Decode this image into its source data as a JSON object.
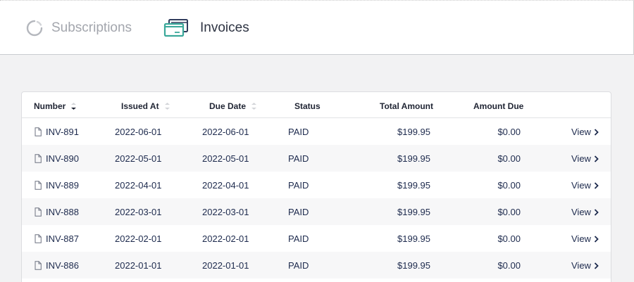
{
  "tabs": {
    "subscriptions": {
      "label": "Subscriptions",
      "icon": "loading-spinner-icon"
    },
    "invoices": {
      "label": "Invoices",
      "icon": "credit-cards-icon",
      "active": true
    }
  },
  "colors": {
    "accent": "#3aa89a",
    "inactive": "#a3a6ad",
    "text": "#1d2a4d"
  },
  "table": {
    "columns": {
      "number": "Number",
      "issued_at": "Issued At",
      "due_date": "Due Date",
      "status": "Status",
      "total_amount": "Total Amount",
      "amount_due": "Amount Due"
    },
    "rows": [
      {
        "number": "INV-891",
        "issued_at": "2022-06-01",
        "due_date": "2022-06-01",
        "status": "PAID",
        "total": "$199.95",
        "due": "$0.00",
        "action": "View"
      },
      {
        "number": "INV-890",
        "issued_at": "2022-05-01",
        "due_date": "2022-05-01",
        "status": "PAID",
        "total": "$199.95",
        "due": "$0.00",
        "action": "View"
      },
      {
        "number": "INV-889",
        "issued_at": "2022-04-01",
        "due_date": "2022-04-01",
        "status": "PAID",
        "total": "$199.95",
        "due": "$0.00",
        "action": "View"
      },
      {
        "number": "INV-888",
        "issued_at": "2022-03-01",
        "due_date": "2022-03-01",
        "status": "PAID",
        "total": "$199.95",
        "due": "$0.00",
        "action": "View"
      },
      {
        "number": "INV-887",
        "issued_at": "2022-02-01",
        "due_date": "2022-02-01",
        "status": "PAID",
        "total": "$199.95",
        "due": "$0.00",
        "action": "View"
      },
      {
        "number": "INV-886",
        "issued_at": "2022-01-01",
        "due_date": "2022-01-01",
        "status": "PAID",
        "total": "$199.95",
        "due": "$0.00",
        "action": "View"
      }
    ]
  }
}
